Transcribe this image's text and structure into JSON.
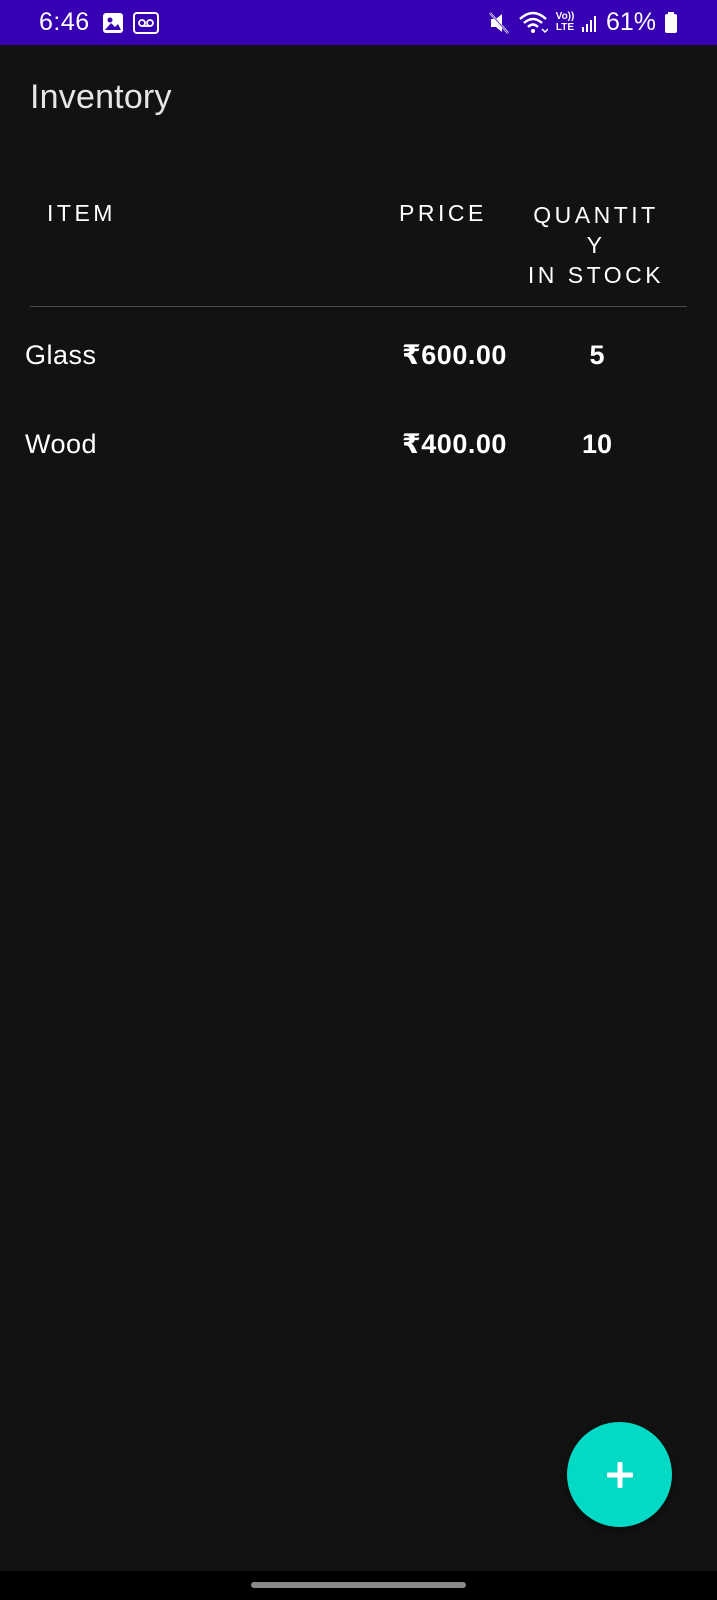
{
  "status_bar": {
    "time": "6:46",
    "battery_percent": "61%",
    "network_label_top": "Vo))",
    "network_label_bottom": "LTE",
    "icons": [
      "gallery-icon",
      "voicemail-icon",
      "mute-icon",
      "wifi-icon",
      "volte-icon",
      "signal-icon",
      "battery-icon"
    ],
    "color": "#3700b3"
  },
  "app_bar": {
    "title": "Inventory"
  },
  "table": {
    "headers": {
      "item": "ITEM",
      "price": "PRICE",
      "quantity_line1": "QUANTIT",
      "quantity_line2": "Y",
      "quantity_line3": "IN STOCK"
    },
    "rows": [
      {
        "name": "Glass",
        "price": "₹600.00",
        "quantity": "5"
      },
      {
        "name": "Wood",
        "price": "₹400.00",
        "quantity": "10"
      }
    ]
  },
  "fab": {
    "icon": "plus-icon",
    "color": "#03dac5"
  },
  "theme": {
    "background": "#121212",
    "text": "#ffffff"
  }
}
